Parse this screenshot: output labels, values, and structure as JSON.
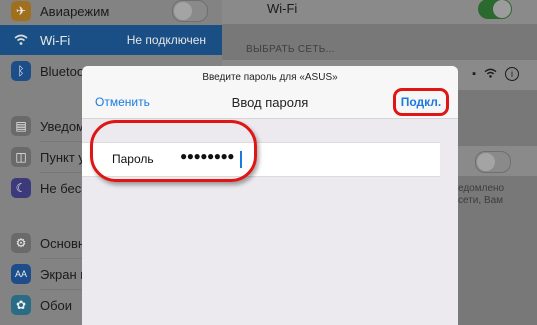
{
  "sidebar": {
    "items": [
      {
        "label": "Авиарежим",
        "icon": "airplane-icon"
      },
      {
        "label": "Wi-Fi",
        "value": "Не подключен",
        "icon": "wifi-icon"
      },
      {
        "label": "Bluetooth",
        "icon": "bluetooth-icon"
      },
      {
        "label": "Уведомления",
        "icon": "notifications-icon"
      },
      {
        "label": "Пункт управления",
        "icon": "control-center-icon"
      },
      {
        "label": "Не беспокоить",
        "icon": "moon-icon"
      },
      {
        "label": "Основные",
        "icon": "gear-icon"
      },
      {
        "label": "Экран и яркость",
        "icon": "display-icon"
      },
      {
        "label": "Обои",
        "icon": "wallpaper-icon"
      }
    ]
  },
  "main": {
    "wifi_label": "Wi-Fi",
    "section_header": "ВЫБРАТЬ СЕТЬ...",
    "hint_text_1": "едомлено",
    "hint_text_2": "сети, Вам"
  },
  "modal": {
    "prompt": "Введите пароль для «ASUS»",
    "title": "Ввод пароля",
    "cancel_label": "Отменить",
    "connect_label": "Подкл.",
    "password_label": "Пароль",
    "password_value": "●●●●●●●●"
  },
  "colors": {
    "accent": "#1a7ae0",
    "highlight": "#e01515"
  }
}
